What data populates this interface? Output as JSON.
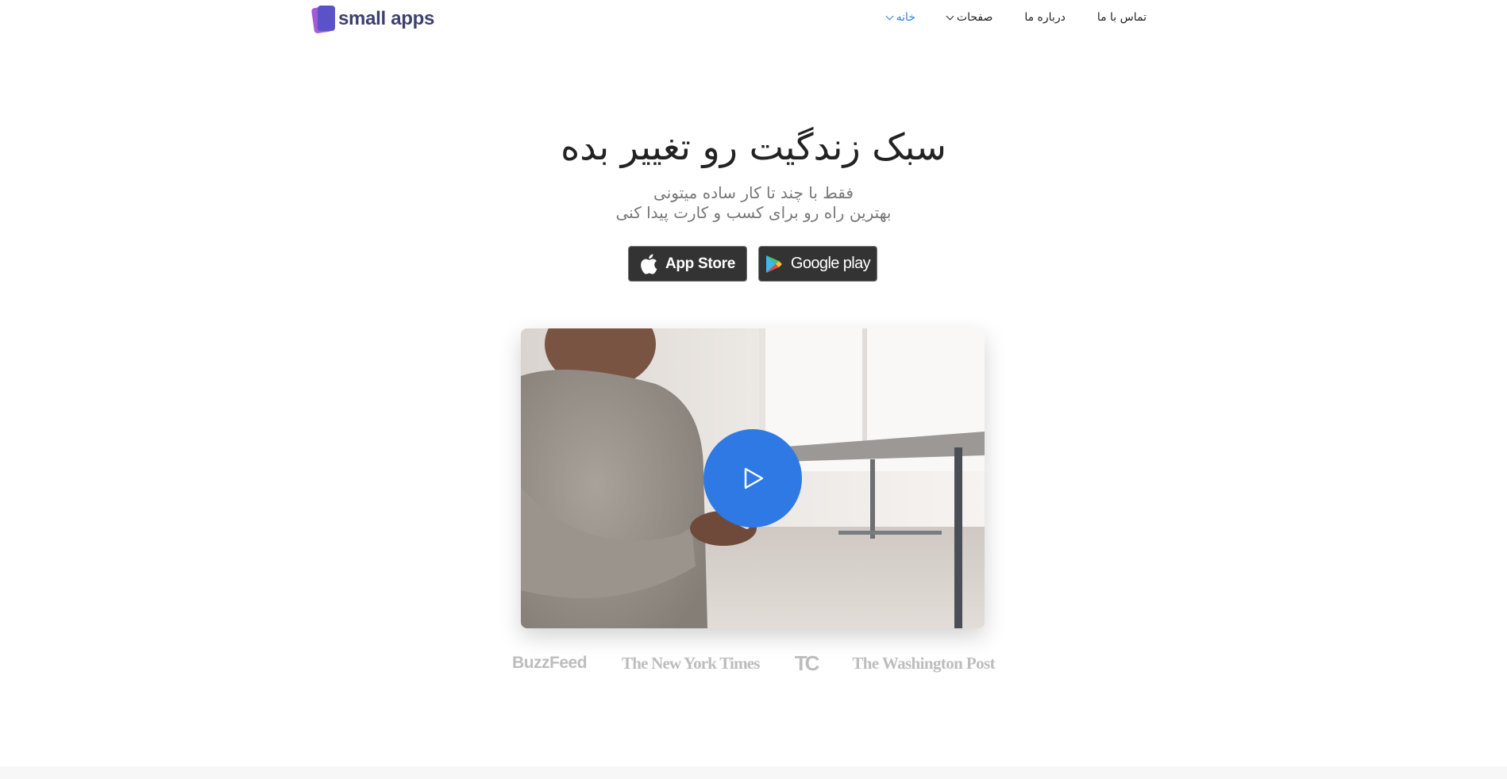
{
  "brand": {
    "name": "small apps"
  },
  "nav": {
    "items": [
      {
        "label": "خانه",
        "has_dropdown": true,
        "active": true
      },
      {
        "label": "صفحات",
        "has_dropdown": true,
        "active": false
      },
      {
        "label": "درباره ما",
        "has_dropdown": false,
        "active": false
      },
      {
        "label": "تماس با ما",
        "has_dropdown": false,
        "active": false
      }
    ]
  },
  "hero": {
    "title": "سبک زندگیت رو تغییر بده",
    "subtitle_line1": "فقط با چند تا کار ساده میتونی",
    "subtitle_line2": "بهترین راه رو برای کسب و کارت پیدا کنی"
  },
  "store_buttons": {
    "app_store": "App Store",
    "google_play": "Google play"
  },
  "video": {
    "play_icon": "play-icon"
  },
  "press_logos": [
    "BuzzFeed",
    "The New York Times",
    "TC",
    "The Washington Post"
  ],
  "colors": {
    "accent": "#2f79e5",
    "nav_active": "#2d7fe0",
    "store_button_bg": "#333333",
    "brand_text": "#3d4170",
    "logo_purple": "#5b52c9"
  }
}
